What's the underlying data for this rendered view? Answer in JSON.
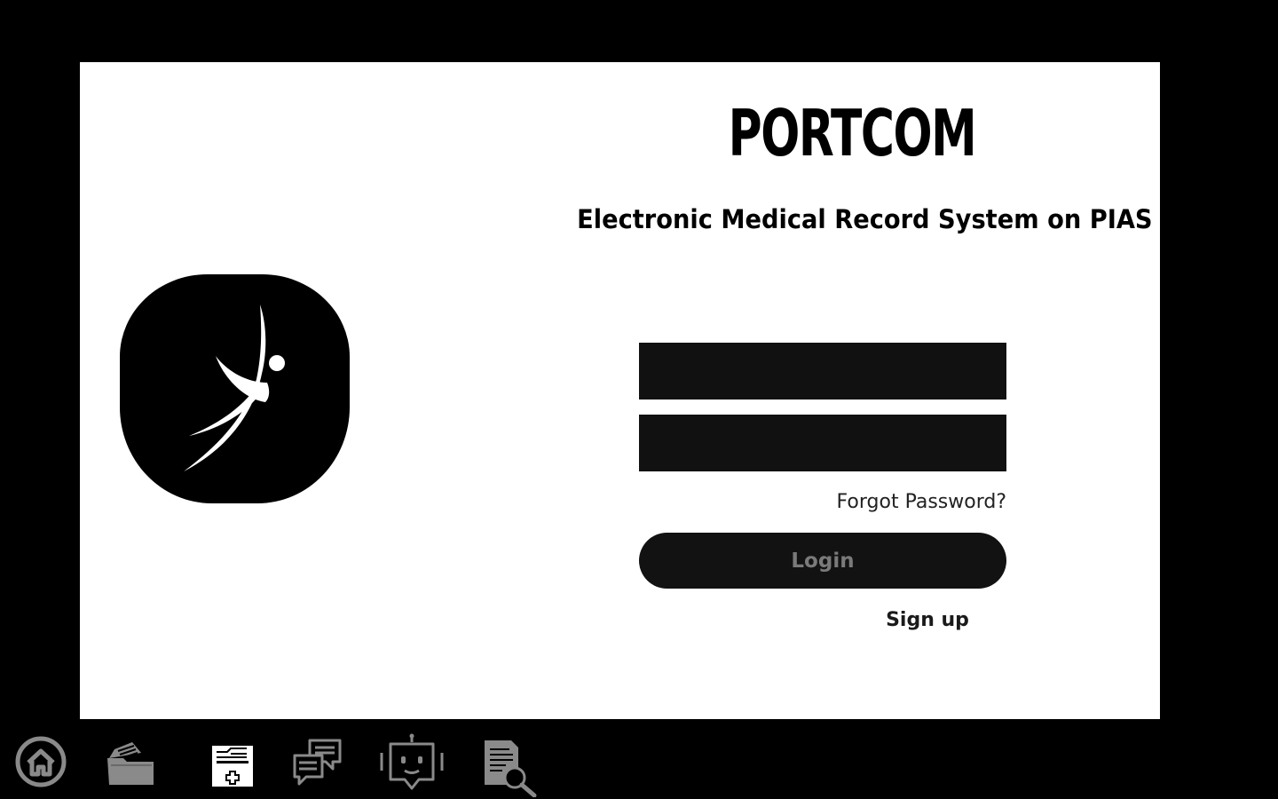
{
  "app": {
    "title": "PORTCOM",
    "subtitle": "Electronic Medical Record System on PIAS"
  },
  "login_form": {
    "username": {
      "value": "",
      "placeholder": ""
    },
    "password": {
      "value": "",
      "placeholder": ""
    },
    "forgot_password_label": "Forgot Password?",
    "login_label": "Login",
    "signup_label": "Sign up"
  },
  "taskbar": {
    "items": [
      {
        "icon": "home-icon"
      },
      {
        "icon": "folder-icon"
      },
      {
        "icon": "medical-record-icon",
        "active": true
      },
      {
        "icon": "chat-icon"
      },
      {
        "icon": "robot-icon"
      },
      {
        "icon": "document-search-icon"
      }
    ]
  },
  "colors": {
    "background": "#000000",
    "panel": "#ffffff",
    "input_fill": "#111111",
    "button_fill": "#121212",
    "button_text": "#7a7a7a",
    "taskbar_icon": "#8a8a8a",
    "taskbar_active_icon": "#ffffff"
  }
}
